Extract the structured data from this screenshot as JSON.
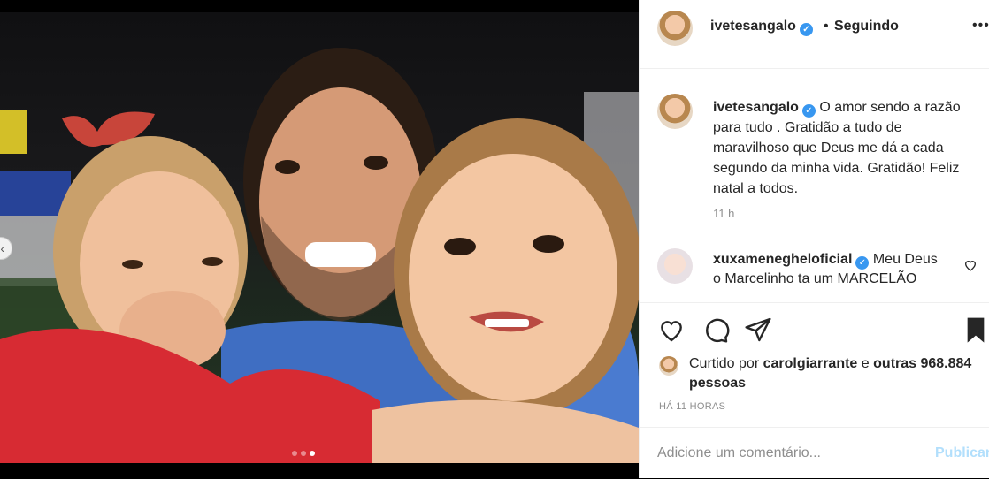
{
  "post": {
    "author": "ivetesangalo",
    "follow_sep": "•",
    "follow_label": "Seguindo",
    "more_icon": "more-horizontal-icon",
    "caption_author": "ivetesangalo",
    "caption_text": "O amor sendo a razão para tudo . Gratidão a tudo de maravilhoso que Deus me dá a cada segundo da minha vida. Gratidão! Feliz natal a todos.",
    "caption_time": "11 h",
    "carousel": {
      "total": 3,
      "active": 3
    }
  },
  "comments": [
    {
      "author": "xuxamenegheloficial",
      "text": "Meu Deus o Marcelinho ta um MARCELÃO"
    }
  ],
  "likes": {
    "prefix": "Curtido por",
    "user": "carolgiarrante",
    "conj": "e",
    "others": "outras 968.884 pessoas"
  },
  "timestamp": "HÁ 11 HORAS",
  "add_comment": {
    "placeholder": "Adicione um comentário...",
    "publish": "Publicar"
  },
  "colors": {
    "verified": "#3897f0",
    "publish_disabled": "#b2dffc",
    "muted": "#8e8e8e"
  }
}
